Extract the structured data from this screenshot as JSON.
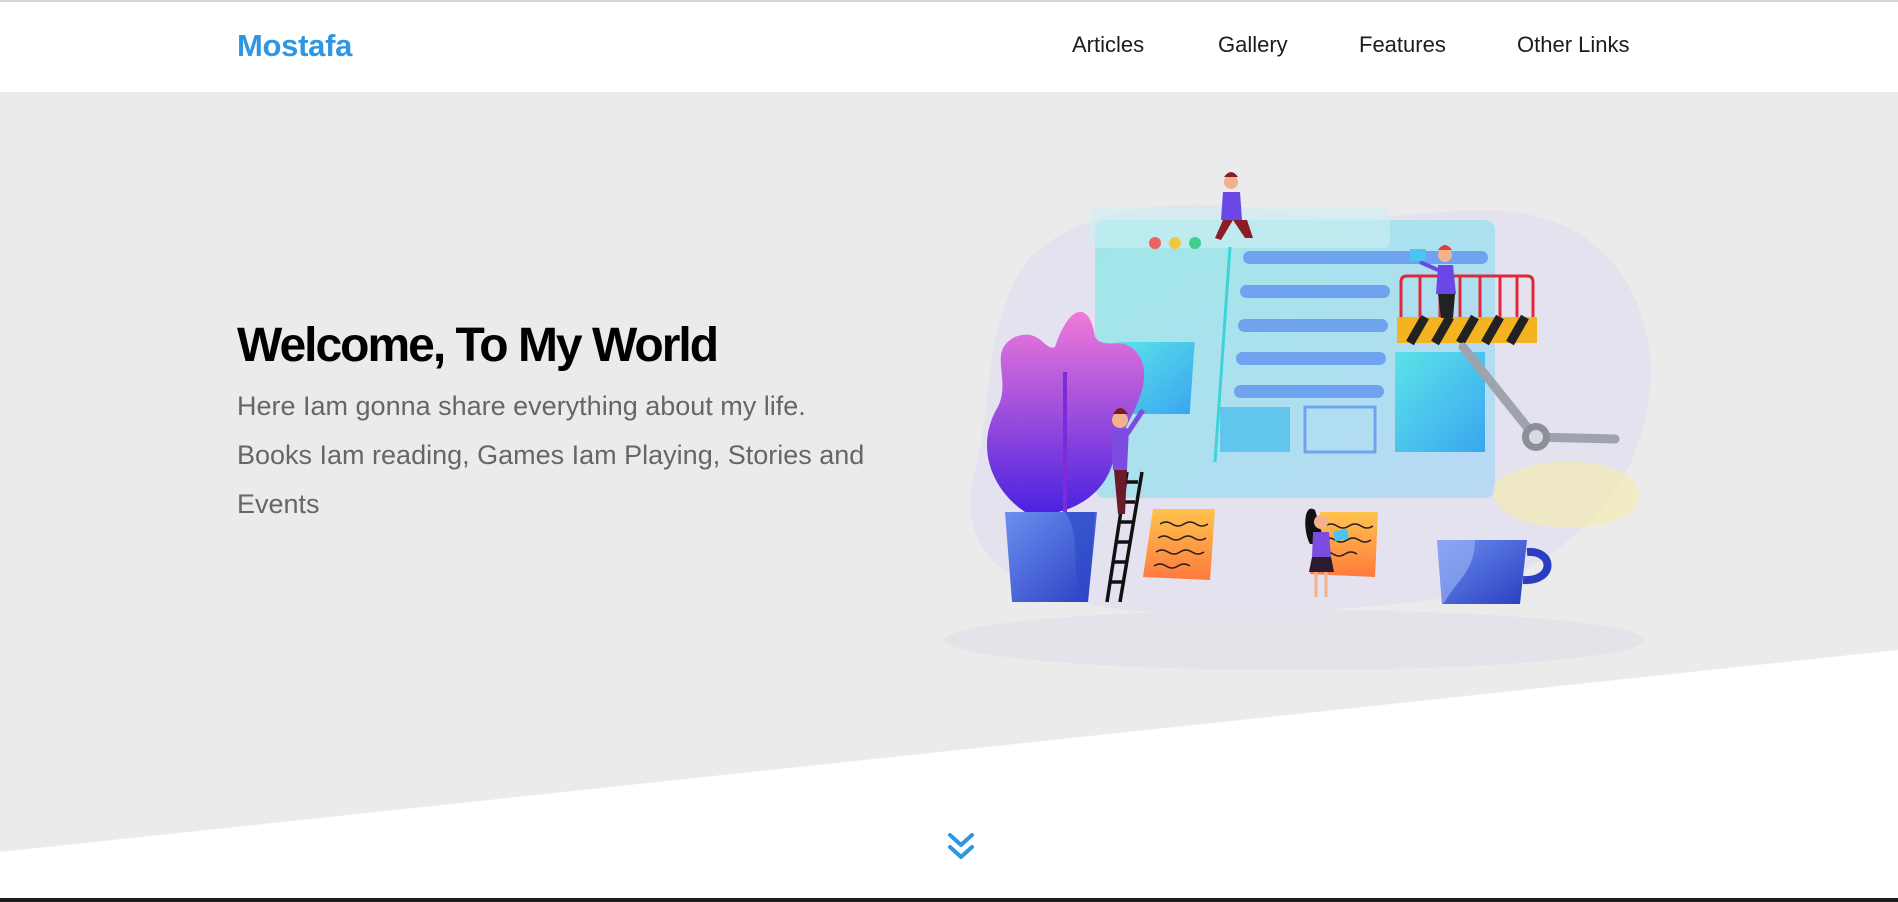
{
  "header": {
    "logo": "Mostafa",
    "nav": [
      {
        "label": "Articles"
      },
      {
        "label": "Gallery"
      },
      {
        "label": "Features"
      },
      {
        "label": "Other Links"
      }
    ]
  },
  "hero": {
    "title": "Welcome, To My World",
    "text": "Here Iam gonna share everything about my life. Books Iam reading, Games Iam Playing, Stories and Events"
  },
  "colors": {
    "brand": "#2f96e3",
    "landing_bg": "#ebebeb",
    "text_muted": "#666666"
  },
  "icons": {
    "scroll": "double-chevron-down-icon"
  }
}
